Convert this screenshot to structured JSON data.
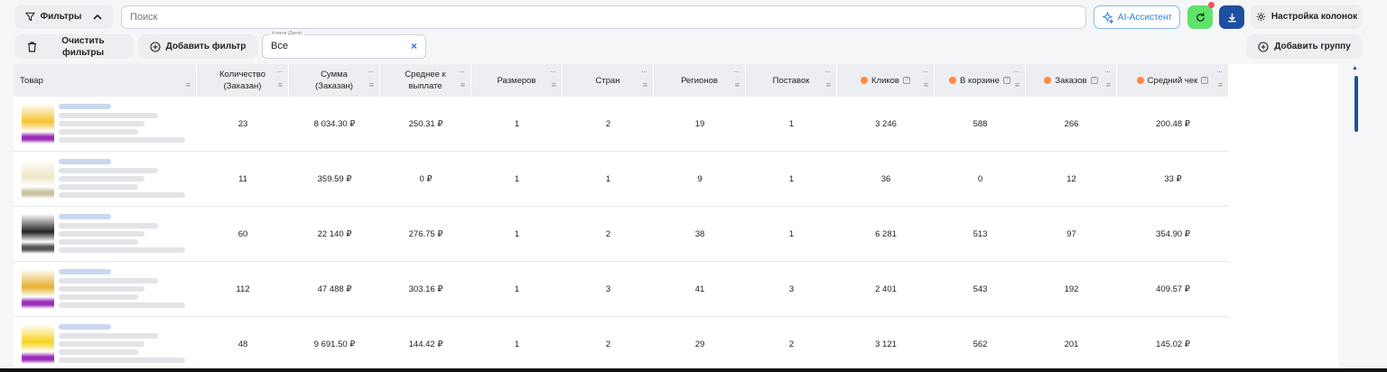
{
  "toolbar": {
    "filters_label": "Фильтры",
    "clear_filters_label": "Очистить фильтры",
    "add_filter_label": "Добавить фильтр",
    "ai_assistant_label": "AI-Ассистент",
    "column_settings_label": "Настройка колонок",
    "add_group_label": "Добавить группу"
  },
  "search": {
    "placeholder": "Поиск"
  },
  "filter_select": {
    "legend": "Кликов (Джем)",
    "value": "Все",
    "clear_symbol": "×"
  },
  "colors": {
    "accent": "#2f7fe0",
    "green": "#5fe36b",
    "navy": "#1f4fa0",
    "orange_dot": "#ff8a3d"
  },
  "table": {
    "headers": [
      {
        "label": "Товар"
      },
      {
        "label": "Количество (Заказан)"
      },
      {
        "label": "Сумма (Заказан)"
      },
      {
        "label": "Среднее к выплате"
      },
      {
        "label": "Размеров"
      },
      {
        "label": "Стран"
      },
      {
        "label": "Регионов"
      },
      {
        "label": "Поставок"
      },
      {
        "label": "Кликов",
        "dot": true,
        "help": true
      },
      {
        "label": "В корзине",
        "dot": true,
        "help": true
      },
      {
        "label": "Заказов",
        "dot": true,
        "help": true
      },
      {
        "label": "Средний чек",
        "dot": true,
        "help": true
      }
    ],
    "rows": [
      {
        "cells": [
          "23",
          "8 034.30 ₽",
          "250.31 ₽",
          "1",
          "2",
          "19",
          "1",
          "3 246",
          "588",
          "266",
          "200.48 ₽"
        ]
      },
      {
        "cells": [
          "11",
          "359.59 ₽",
          "0 ₽",
          "1",
          "1",
          "9",
          "1",
          "36",
          "0",
          "12",
          "33 ₽"
        ]
      },
      {
        "cells": [
          "60",
          "22 140 ₽",
          "276.75 ₽",
          "1",
          "2",
          "38",
          "1",
          "6 281",
          "513",
          "97",
          "354.90 ₽"
        ]
      },
      {
        "cells": [
          "112",
          "47 488 ₽",
          "303.16 ₽",
          "1",
          "3",
          "41",
          "3",
          "2 401",
          "543",
          "192",
          "409.57 ₽"
        ]
      },
      {
        "cells": [
          "48",
          "9 691.50 ₽",
          "144.42 ₽",
          "1",
          "2",
          "29",
          "2",
          "3 121",
          "562",
          "201",
          "145.02 ₽"
        ]
      }
    ]
  }
}
